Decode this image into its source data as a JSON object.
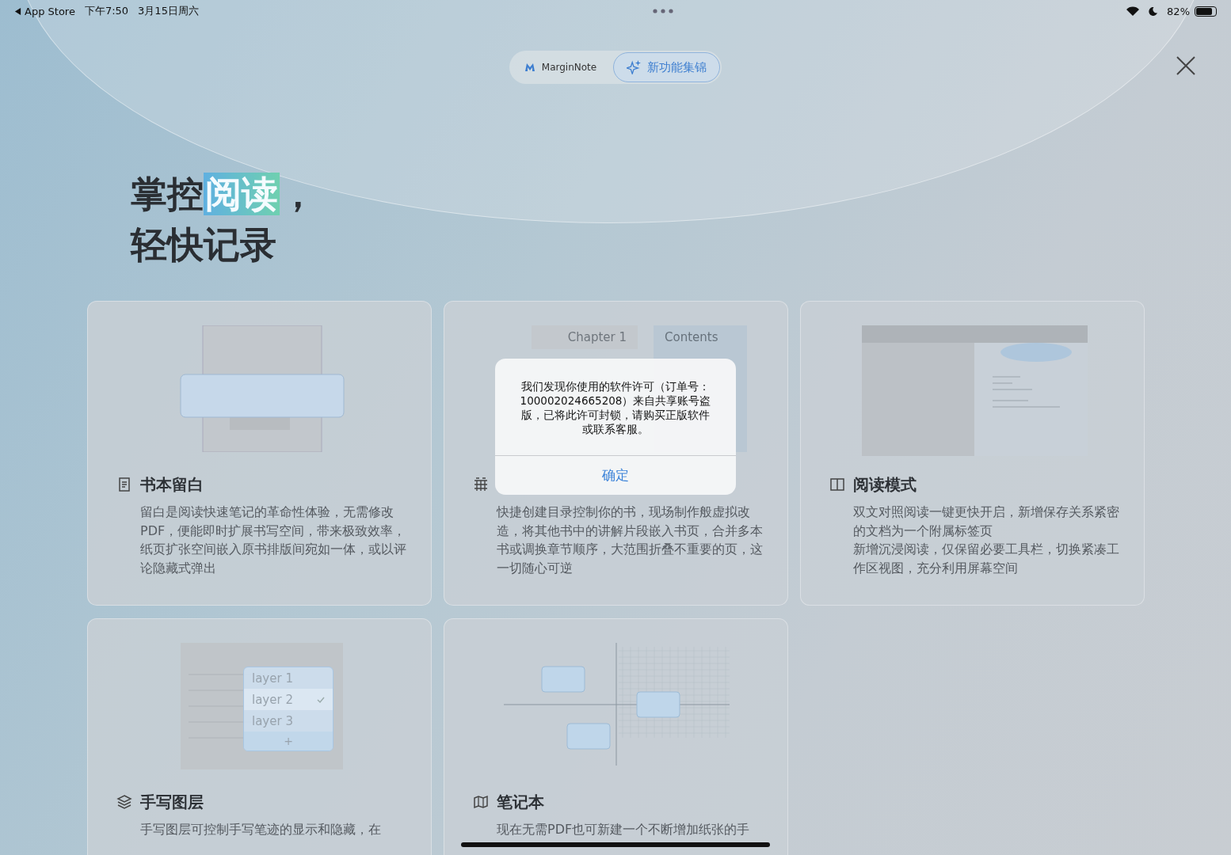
{
  "status_bar": {
    "back_label": "App Store",
    "time": "下午7:50",
    "date": "3月15日周六",
    "battery": "82%"
  },
  "header": {
    "segments": [
      {
        "label": "MarginNote",
        "kind": "logo",
        "selected": false
      },
      {
        "label": "新功能集锦",
        "kind": "sparkle",
        "selected": true
      }
    ]
  },
  "headline": [
    [
      {
        "text": "掌控",
        "highlight": false
      },
      {
        "text": "阅读",
        "highlight": true
      },
      {
        "text": "，",
        "highlight": false
      }
    ],
    [
      {
        "text": "轻快记录",
        "highlight": false
      }
    ]
  ],
  "cards": [
    {
      "kind": "margin",
      "title": "书本留白",
      "description": [
        "留白是阅读快速笔记的革命性体验，无需修改PDF，便能即时扩展书写空间，带来极致效率，纸页扩张空间嵌入原书排版间宛如一体，或以评论隐藏式弹出"
      ]
    },
    {
      "kind": "toc",
      "illustration": {
        "chapter": "Chapter 1",
        "contents": "Contents"
      },
      "description": [
        "快捷创建目录控制你的书，现场制作般虚拟改造，将其他书中的讲解片段嵌入书页，合并多本书或调换章节顺序，大范围折叠不重要的页，这一切随心可逆"
      ]
    },
    {
      "kind": "reading",
      "title": "阅读模式",
      "description": [
        "双文对照阅读一键更快开启，新增保存关系紧密的文档为一个附属标签页",
        "新增沉浸阅读，仅保留必要工具栏，切换紧凑工作区视图，充分利用屏幕空间"
      ]
    },
    {
      "kind": "layers",
      "illustration": {
        "layers": [
          {
            "label": "layer 1",
            "selected": false
          },
          {
            "label": "layer 2",
            "selected": true
          },
          {
            "label": "layer 3",
            "selected": false
          }
        ],
        "add": "+"
      },
      "title": "手写图层",
      "description": [
        "手写图层可控制手写笔迹的显示和隐藏，在"
      ]
    },
    {
      "kind": "notebook",
      "title": "笔记本",
      "description": [
        "现在无需PDF也可新建一个不断增加纸张的手"
      ]
    }
  ],
  "alert": {
    "message": "我们发现你使用的软件许可（订单号：100002024665208）来自共享账号盗版，已将此许可封锁，请购买正版软件或联系客服。",
    "button": "确定"
  }
}
